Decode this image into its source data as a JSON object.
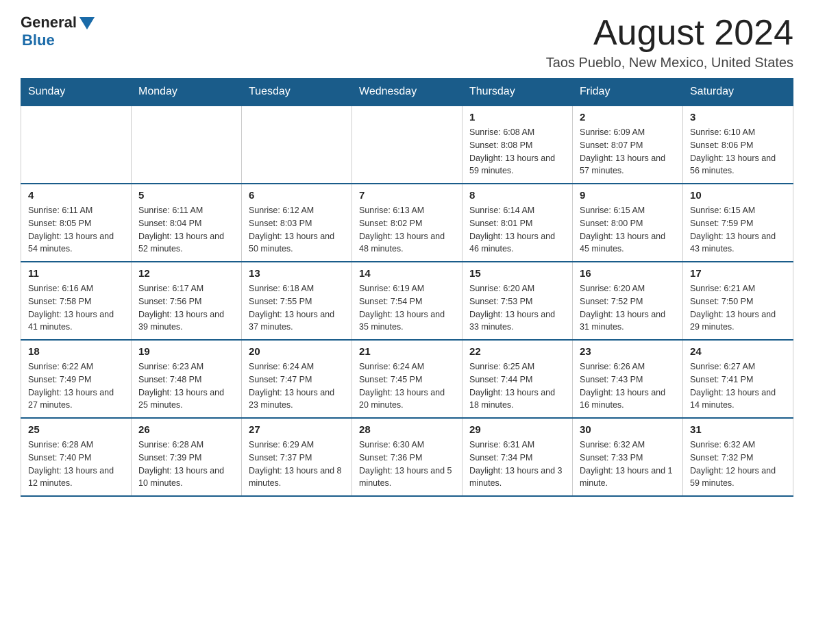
{
  "header": {
    "logo": {
      "text_general": "General",
      "text_blue": "Blue"
    },
    "title": "August 2024",
    "location": "Taos Pueblo, New Mexico, United States"
  },
  "days_of_week": [
    "Sunday",
    "Monday",
    "Tuesday",
    "Wednesday",
    "Thursday",
    "Friday",
    "Saturday"
  ],
  "weeks": [
    [
      {
        "day": "",
        "info": ""
      },
      {
        "day": "",
        "info": ""
      },
      {
        "day": "",
        "info": ""
      },
      {
        "day": "",
        "info": ""
      },
      {
        "day": "1",
        "info": "Sunrise: 6:08 AM\nSunset: 8:08 PM\nDaylight: 13 hours and 59 minutes."
      },
      {
        "day": "2",
        "info": "Sunrise: 6:09 AM\nSunset: 8:07 PM\nDaylight: 13 hours and 57 minutes."
      },
      {
        "day": "3",
        "info": "Sunrise: 6:10 AM\nSunset: 8:06 PM\nDaylight: 13 hours and 56 minutes."
      }
    ],
    [
      {
        "day": "4",
        "info": "Sunrise: 6:11 AM\nSunset: 8:05 PM\nDaylight: 13 hours and 54 minutes."
      },
      {
        "day": "5",
        "info": "Sunrise: 6:11 AM\nSunset: 8:04 PM\nDaylight: 13 hours and 52 minutes."
      },
      {
        "day": "6",
        "info": "Sunrise: 6:12 AM\nSunset: 8:03 PM\nDaylight: 13 hours and 50 minutes."
      },
      {
        "day": "7",
        "info": "Sunrise: 6:13 AM\nSunset: 8:02 PM\nDaylight: 13 hours and 48 minutes."
      },
      {
        "day": "8",
        "info": "Sunrise: 6:14 AM\nSunset: 8:01 PM\nDaylight: 13 hours and 46 minutes."
      },
      {
        "day": "9",
        "info": "Sunrise: 6:15 AM\nSunset: 8:00 PM\nDaylight: 13 hours and 45 minutes."
      },
      {
        "day": "10",
        "info": "Sunrise: 6:15 AM\nSunset: 7:59 PM\nDaylight: 13 hours and 43 minutes."
      }
    ],
    [
      {
        "day": "11",
        "info": "Sunrise: 6:16 AM\nSunset: 7:58 PM\nDaylight: 13 hours and 41 minutes."
      },
      {
        "day": "12",
        "info": "Sunrise: 6:17 AM\nSunset: 7:56 PM\nDaylight: 13 hours and 39 minutes."
      },
      {
        "day": "13",
        "info": "Sunrise: 6:18 AM\nSunset: 7:55 PM\nDaylight: 13 hours and 37 minutes."
      },
      {
        "day": "14",
        "info": "Sunrise: 6:19 AM\nSunset: 7:54 PM\nDaylight: 13 hours and 35 minutes."
      },
      {
        "day": "15",
        "info": "Sunrise: 6:20 AM\nSunset: 7:53 PM\nDaylight: 13 hours and 33 minutes."
      },
      {
        "day": "16",
        "info": "Sunrise: 6:20 AM\nSunset: 7:52 PM\nDaylight: 13 hours and 31 minutes."
      },
      {
        "day": "17",
        "info": "Sunrise: 6:21 AM\nSunset: 7:50 PM\nDaylight: 13 hours and 29 minutes."
      }
    ],
    [
      {
        "day": "18",
        "info": "Sunrise: 6:22 AM\nSunset: 7:49 PM\nDaylight: 13 hours and 27 minutes."
      },
      {
        "day": "19",
        "info": "Sunrise: 6:23 AM\nSunset: 7:48 PM\nDaylight: 13 hours and 25 minutes."
      },
      {
        "day": "20",
        "info": "Sunrise: 6:24 AM\nSunset: 7:47 PM\nDaylight: 13 hours and 23 minutes."
      },
      {
        "day": "21",
        "info": "Sunrise: 6:24 AM\nSunset: 7:45 PM\nDaylight: 13 hours and 20 minutes."
      },
      {
        "day": "22",
        "info": "Sunrise: 6:25 AM\nSunset: 7:44 PM\nDaylight: 13 hours and 18 minutes."
      },
      {
        "day": "23",
        "info": "Sunrise: 6:26 AM\nSunset: 7:43 PM\nDaylight: 13 hours and 16 minutes."
      },
      {
        "day": "24",
        "info": "Sunrise: 6:27 AM\nSunset: 7:41 PM\nDaylight: 13 hours and 14 minutes."
      }
    ],
    [
      {
        "day": "25",
        "info": "Sunrise: 6:28 AM\nSunset: 7:40 PM\nDaylight: 13 hours and 12 minutes."
      },
      {
        "day": "26",
        "info": "Sunrise: 6:28 AM\nSunset: 7:39 PM\nDaylight: 13 hours and 10 minutes."
      },
      {
        "day": "27",
        "info": "Sunrise: 6:29 AM\nSunset: 7:37 PM\nDaylight: 13 hours and 8 minutes."
      },
      {
        "day": "28",
        "info": "Sunrise: 6:30 AM\nSunset: 7:36 PM\nDaylight: 13 hours and 5 minutes."
      },
      {
        "day": "29",
        "info": "Sunrise: 6:31 AM\nSunset: 7:34 PM\nDaylight: 13 hours and 3 minutes."
      },
      {
        "day": "30",
        "info": "Sunrise: 6:32 AM\nSunset: 7:33 PM\nDaylight: 13 hours and 1 minute."
      },
      {
        "day": "31",
        "info": "Sunrise: 6:32 AM\nSunset: 7:32 PM\nDaylight: 12 hours and 59 minutes."
      }
    ]
  ]
}
